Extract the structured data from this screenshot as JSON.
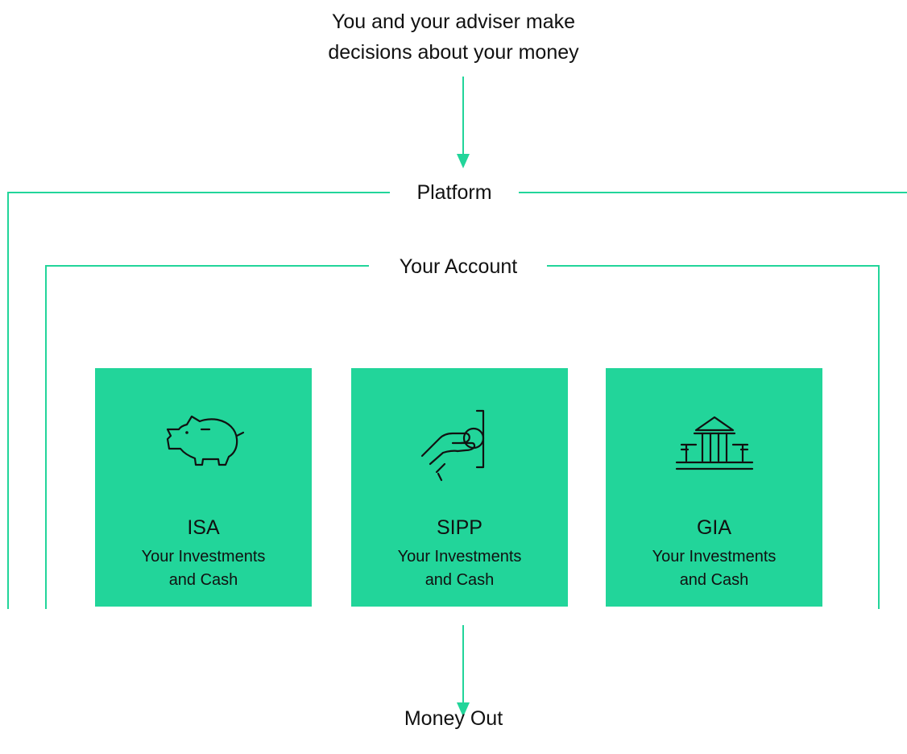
{
  "top": {
    "line1": "You and your adviser make",
    "line2": "decisions about your money"
  },
  "platform": {
    "label": "Platform"
  },
  "account": {
    "label": "Your Account"
  },
  "cards": [
    {
      "title": "ISA",
      "sub1": "Your Investments",
      "sub2": "and Cash",
      "icon": "piggy-bank-icon"
    },
    {
      "title": "SIPP",
      "sub1": "Your Investments",
      "sub2": "and Cash",
      "icon": "hand-coin-icon"
    },
    {
      "title": "GIA",
      "sub1": "Your Investments",
      "sub2": "and Cash",
      "icon": "bank-building-icon"
    }
  ],
  "bottom": {
    "label": "Money Out"
  },
  "colors": {
    "accent": "#22d59a",
    "text": "#111111",
    "background": "#ffffff"
  }
}
